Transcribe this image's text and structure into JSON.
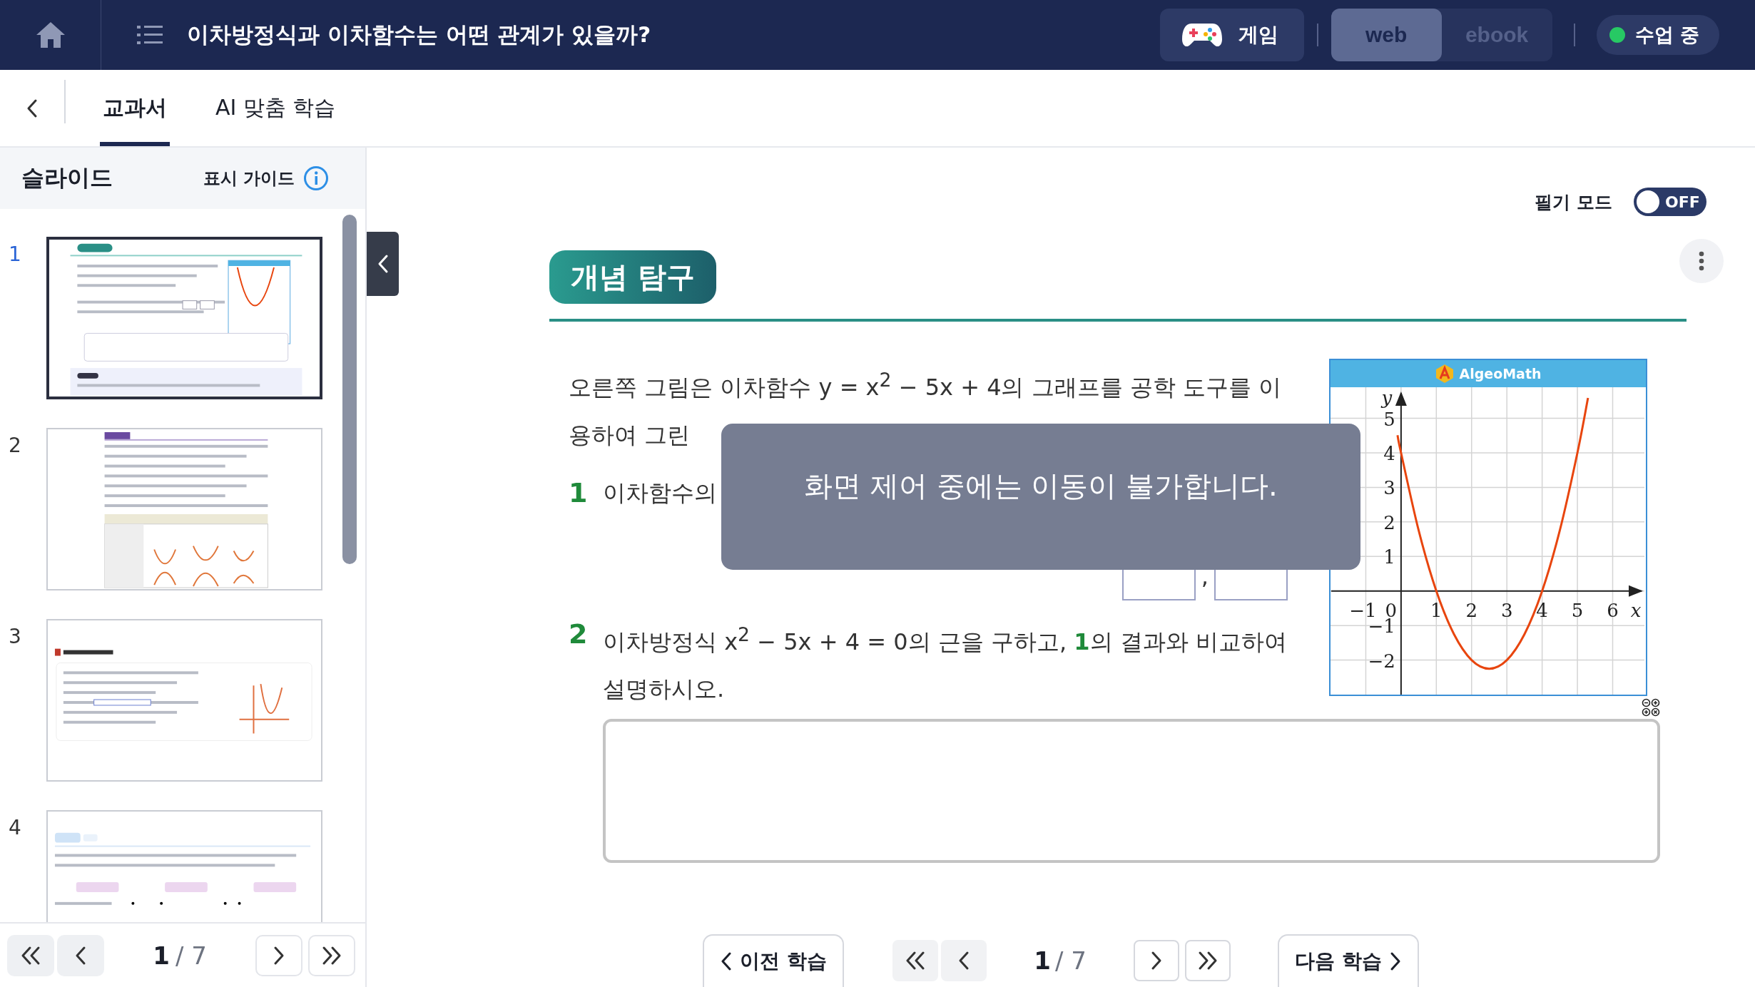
{
  "header": {
    "title": "이차방정식과 이차함수는 어떤 관계가 있을까?",
    "game_button": "게임",
    "view_modes": [
      {
        "label": "web",
        "selected": true
      },
      {
        "label": "ebook",
        "selected": false
      }
    ],
    "class_status": {
      "label": "수업 중",
      "on": true
    }
  },
  "tabs": [
    {
      "label": "교과서",
      "selected": true
    },
    {
      "label": "AI 맞춤 학습",
      "selected": false
    }
  ],
  "sidebar": {
    "title": "슬라이드",
    "guide": "표시 가이드",
    "slides": [
      {
        "number": "1",
        "selected": true
      },
      {
        "number": "2",
        "selected": false
      },
      {
        "number": "3",
        "selected": false
      },
      {
        "number": "4",
        "selected": false
      }
    ],
    "pager": {
      "current": "1",
      "total": "/ 7"
    }
  },
  "main": {
    "note_mode": {
      "label": "필기 모드",
      "on": false,
      "state_text": "OFF"
    },
    "section_badge": "개념 탐구",
    "intro": "오른쪽 그림은 이차함수 y = x$^{2}$ − 5x + 4의 그래프를 공학 도구를 이용하여 그린",
    "questions": [
      {
        "number": "1",
        "text": "이차함수의"
      },
      {
        "number": "2",
        "text": "이차방정식 x$^{2}$ − 5x + 4 = 0의 근을 구하고, **1**의 결과와 비교하여 설명하시오."
      }
    ],
    "blank_separator": ",",
    "graph": {
      "logo": "AlgeoMath",
      "chart_data": {
        "type": "line",
        "xlabel": "x",
        "ylabel": "y",
        "grid": true,
        "x": [
          -0.1,
          0,
          0.5,
          1,
          1.5,
          2,
          2.5,
          3,
          3.5,
          4,
          4.5,
          5,
          5.3
        ],
        "series": [
          {
            "color": "#e8450e",
            "values": [
              4.51,
              4,
              1.75,
              0,
              -1.25,
              -2,
              -2.25,
              -2,
              -1.25,
              0,
              1.75,
              4,
              5.59
            ]
          }
        ],
        "xlim": [
          -2,
          6.9
        ],
        "ylim": [
          -3,
          5.9
        ],
        "xticks": [
          {
            "value": -1,
            "label": "−1"
          },
          1,
          2,
          3,
          4,
          5,
          6
        ],
        "yticks": [
          {
            "value": -2,
            "label": "−2"
          },
          {
            "value": -1,
            "label": "−1"
          },
          1,
          2,
          3,
          4,
          5
        ]
      },
      "origin_label": "0"
    },
    "overlay": {
      "message": "화면 제어 중에는 이동이 불가합니다."
    }
  },
  "bottom_nav": {
    "prev": "이전 학습",
    "next": "다음 학습",
    "current": "1",
    "total": "/ 7"
  }
}
